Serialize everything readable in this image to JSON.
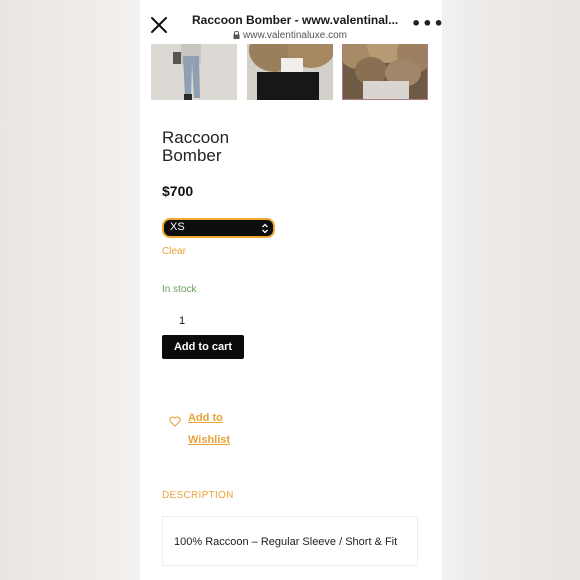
{
  "browser": {
    "title": "Raccoon Bomber - www.valentinal...",
    "url": "www.valentinaluxe.com",
    "close_icon": "close-icon",
    "more_icon": "more-icon",
    "more_label": "•••"
  },
  "gallery": {
    "thumbnails": [
      "thumbnail-1",
      "thumbnail-2",
      "thumbnail-3"
    ]
  },
  "product": {
    "title": "Raccoon Bomber",
    "price": "$700",
    "size_selected": "XS",
    "clear_label": "Clear",
    "stock_status": "In stock",
    "quantity": "1",
    "add_to_cart_label": "Add to cart",
    "wishlist_label": "Add to Wishlist"
  },
  "description": {
    "heading": "DESCRIPTION",
    "text": "100% Raccoon – Regular Sleeve / Short & Fit"
  },
  "colors": {
    "accent": "#e8a23a",
    "stock": "#6a9a5e",
    "button": "#0b0b0b",
    "select_border": "#f0a92e"
  }
}
